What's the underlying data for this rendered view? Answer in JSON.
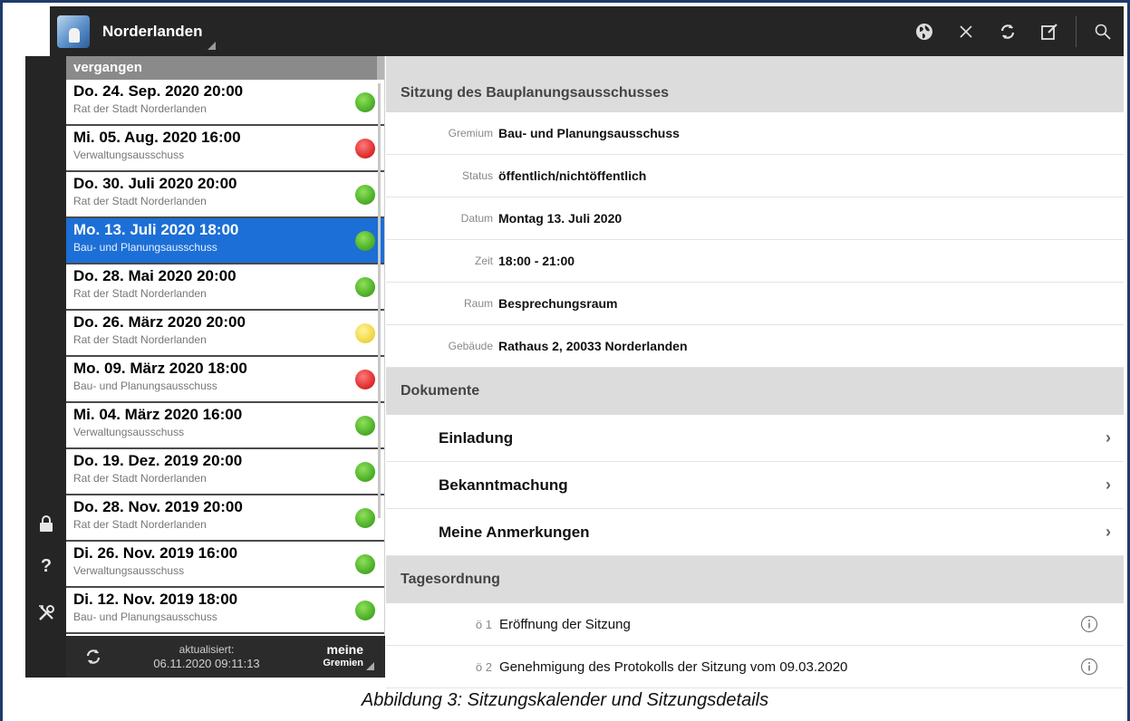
{
  "app": {
    "title": "Norderlanden"
  },
  "toolbar": {
    "icons": [
      "globe-icon",
      "close-icon",
      "refresh-icon",
      "edit-icon",
      "search-icon"
    ]
  },
  "sidebar": {
    "icons": [
      "lock-icon",
      "help-icon",
      "tools-icon"
    ]
  },
  "list": {
    "header": "vergangen",
    "items": [
      {
        "date": "Do. 24. Sep. 2020  20:00",
        "body": "Rat der Stadt Norderlanden",
        "status": "green"
      },
      {
        "date": "Mi. 05. Aug. 2020  16:00",
        "body": "Verwaltungsausschuss",
        "status": "red"
      },
      {
        "date": "Do. 30. Juli 2020  20:00",
        "body": "Rat der Stadt Norderlanden",
        "status": "green"
      },
      {
        "date": "Mo. 13. Juli 2020  18:00",
        "body": "Bau- und Planungsausschuss",
        "status": "green",
        "selected": true
      },
      {
        "date": "Do. 28. Mai 2020  20:00",
        "body": "Rat der Stadt Norderlanden",
        "status": "green"
      },
      {
        "date": "Do. 26. März 2020  20:00",
        "body": "Rat der Stadt Norderlanden",
        "status": "yellow"
      },
      {
        "date": "Mo. 09. März 2020  18:00",
        "body": "Bau- und Planungsausschuss",
        "status": "red"
      },
      {
        "date": "Mi. 04. März 2020  16:00",
        "body": "Verwaltungsausschuss",
        "status": "green"
      },
      {
        "date": "Do. 19. Dez. 2019  20:00",
        "body": "Rat der Stadt Norderlanden",
        "status": "green"
      },
      {
        "date": "Do. 28. Nov. 2019  20:00",
        "body": "Rat der Stadt Norderlanden",
        "status": "green"
      },
      {
        "date": "Di. 26. Nov. 2019  16:00",
        "body": "Verwaltungsausschuss",
        "status": "green"
      },
      {
        "date": "Di. 12. Nov. 2019  18:00",
        "body": "Bau- und Planungsausschuss",
        "status": "green"
      }
    ],
    "footer": {
      "updated_label": "aktualisiert:",
      "updated_value": "06.11.2020 09:11:13",
      "filter_line1": "meine",
      "filter_line2": "Gremien"
    }
  },
  "detail": {
    "title": "Sitzung des Bauplanungsausschusses",
    "fields": [
      {
        "label": "Gremium",
        "value": "Bau- und Planungsausschuss"
      },
      {
        "label": "Status",
        "value": "öffentlich/nichtöffentlich"
      },
      {
        "label": "Datum",
        "value": "Montag 13. Juli 2020"
      },
      {
        "label": "Zeit",
        "value": "18:00 - 21:00"
      },
      {
        "label": "Raum",
        "value": "Besprechungsraum"
      },
      {
        "label": "Gebäude",
        "value": "Rathaus 2, 20033 Norderlanden"
      }
    ],
    "documents_header": "Dokumente",
    "documents": [
      "Einladung",
      "Bekanntmachung",
      "Meine Anmerkungen"
    ],
    "agenda_header": "Tagesordnung",
    "agenda": [
      {
        "num": "ö 1",
        "title": "Eröffnung der Sitzung"
      },
      {
        "num": "ö 2",
        "title": "Genehmigung des Protokolls der Sitzung vom 09.03.2020"
      }
    ]
  },
  "caption": "Abbildung 3: Sitzungskalender und Sitzungsdetails",
  "colors": {
    "topbar": "#252525",
    "selected": "#1c6fd6",
    "green": "#4fb22a",
    "red": "#e03232",
    "yellow": "#f2d94a"
  }
}
